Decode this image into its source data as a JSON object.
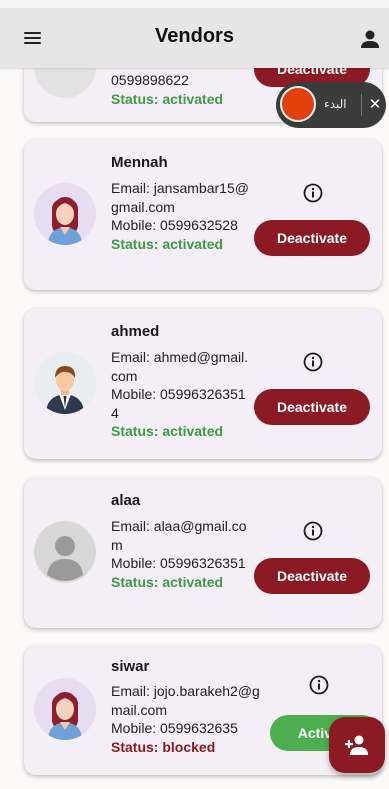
{
  "appbar": {
    "title": "Vendors",
    "menu_icon": "menu-icon",
    "profile_icon": "person-icon"
  },
  "recorder": {
    "label": "البدء",
    "close": "✕"
  },
  "vendors": [
    {
      "name": "",
      "email_label": "",
      "mobile_label": "0599898622",
      "status": "Status: activated",
      "action": "Deactivate"
    },
    {
      "name": "Mennah",
      "email_label": "Email: jansambar15@gmail.com",
      "mobile_label": "Mobile: 0599632528",
      "status": "Status: activated",
      "action": "Deactivate"
    },
    {
      "name": "ahmed",
      "email_label": "Email: ahmed@gmail.com",
      "mobile_label": "Mobile: 059963263514",
      "status": "Status: activated",
      "action": "Deactivate"
    },
    {
      "name": "alaa",
      "email_label": "Email: alaa@gmail.com",
      "mobile_label": "Mobile: 05996326351",
      "status": "Status: activated",
      "action": "Deactivate"
    },
    {
      "name": "siwar",
      "email_label": "Email: jojo.barakeh2@gmail.com",
      "mobile_label": "Mobile: 0599632635",
      "status": "Status: blocked",
      "action": "Activate"
    }
  ],
  "colors": {
    "primary": "#8b1a24",
    "activated": "#3f9a47",
    "blocked": "#8b1a1e",
    "activate_button": "#4cae4f",
    "card_bg": "#f4eff6"
  },
  "fab_icon": "add-person-icon"
}
